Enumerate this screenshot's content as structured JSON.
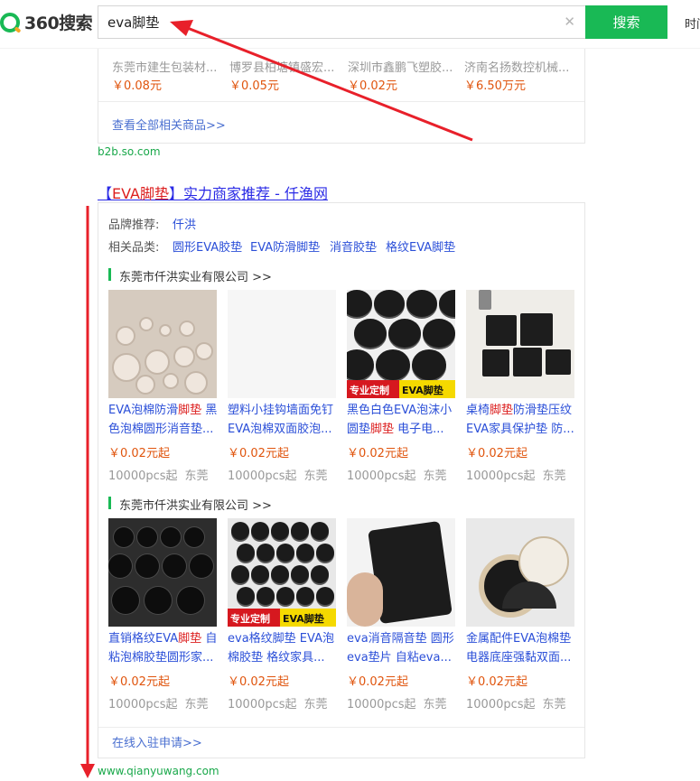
{
  "header": {
    "logo_text": "360搜索",
    "search_value": "eva脚垫",
    "clear_icon": "close-icon",
    "search_button": "搜索",
    "extra": "时间"
  },
  "b2b": {
    "products": [
      {
        "name": "东莞市建生包装材...",
        "price": "￥0.08元"
      },
      {
        "name": "博罗县柏塘镇盛宏...",
        "price": "￥0.05元"
      },
      {
        "name": "深圳市鑫鹏飞塑胶...",
        "price": "￥0.02元"
      },
      {
        "name": "济南名扬数控机械...",
        "price": "￥6.50万元"
      }
    ],
    "view_all": "查看全部相关商品>>",
    "domain": "b2b.so.com"
  },
  "result": {
    "title_prefix": "【",
    "title_highlight": "EVA脚垫",
    "title_suffix": "】实力商家推荐 - 仟渔网",
    "brand_label": "品牌推荐:",
    "brand": "仟洪",
    "related_label": "相关品类:",
    "related": [
      "圆形EVA胶垫",
      "EVA防滑脚垫",
      "消音胶垫",
      "格纹EVA脚垫"
    ],
    "groups": [
      {
        "company": "东莞市仟洪实业有限公司 >>",
        "products": [
          {
            "desc_pre": "EVA泡棉防滑",
            "desc_hl": "脚垫",
            "desc_post": " 黑色泡棉圆形消音垫...",
            "price": "￥0.02元起",
            "qty": "10000pcs起",
            "loc": "东莞",
            "banner": ""
          },
          {
            "desc_pre": "塑料小挂钩墙面免钉EVA泡棉双面胶泡...",
            "desc_hl": "",
            "desc_post": "",
            "price": "￥0.02元起",
            "qty": "10000pcs起",
            "loc": "东莞",
            "banner": ""
          },
          {
            "desc_pre": "黑色白色EVA泡沫小圆垫",
            "desc_hl": "脚垫",
            "desc_post": " 电子电...",
            "price": "￥0.02元起",
            "qty": "10000pcs起",
            "loc": "东莞",
            "banner": "专业定制|EVA脚垫"
          },
          {
            "desc_pre": "桌椅",
            "desc_hl": "脚垫",
            "desc_post": "防滑垫压纹EVA家具保护垫 防...",
            "price": "￥0.02元起",
            "qty": "10000pcs起",
            "loc": "东莞",
            "banner": ""
          }
        ]
      },
      {
        "company": "东莞市仟洪实业有限公司 >>",
        "products": [
          {
            "desc_pre": "直销格纹EVA",
            "desc_hl": "脚垫",
            "desc_post": " 自粘泡棉胶垫圆形家...",
            "price": "￥0.02元起",
            "qty": "10000pcs起",
            "loc": "东莞",
            "banner": ""
          },
          {
            "desc_pre": "eva格纹脚垫 EVA泡棉胶垫 格纹家具...",
            "desc_hl": "",
            "desc_post": "",
            "price": "￥0.02元起",
            "qty": "10000pcs起",
            "loc": "东莞",
            "banner": "专业定制|EVA脚垫"
          },
          {
            "desc_pre": "eva消音隔音垫 圆形eva垫片 自粘eva...",
            "desc_hl": "",
            "desc_post": "",
            "price": "￥0.02元起",
            "qty": "10000pcs起",
            "loc": "东莞",
            "banner": ""
          },
          {
            "desc_pre": "金属配件EVA泡棉垫电器底座强黏双面...",
            "desc_hl": "",
            "desc_post": "",
            "price": "￥0.02元起",
            "qty": "10000pcs起",
            "loc": "东莞",
            "banner": ""
          }
        ]
      }
    ],
    "apply": "在线入驻申请>>",
    "domain": "www.qianyuwang.com"
  },
  "colors": {
    "brand_green": "#19b955",
    "link_blue": "#2b4fd8",
    "price_orange": "#e0550e",
    "annotation_red": "#e8202a"
  }
}
